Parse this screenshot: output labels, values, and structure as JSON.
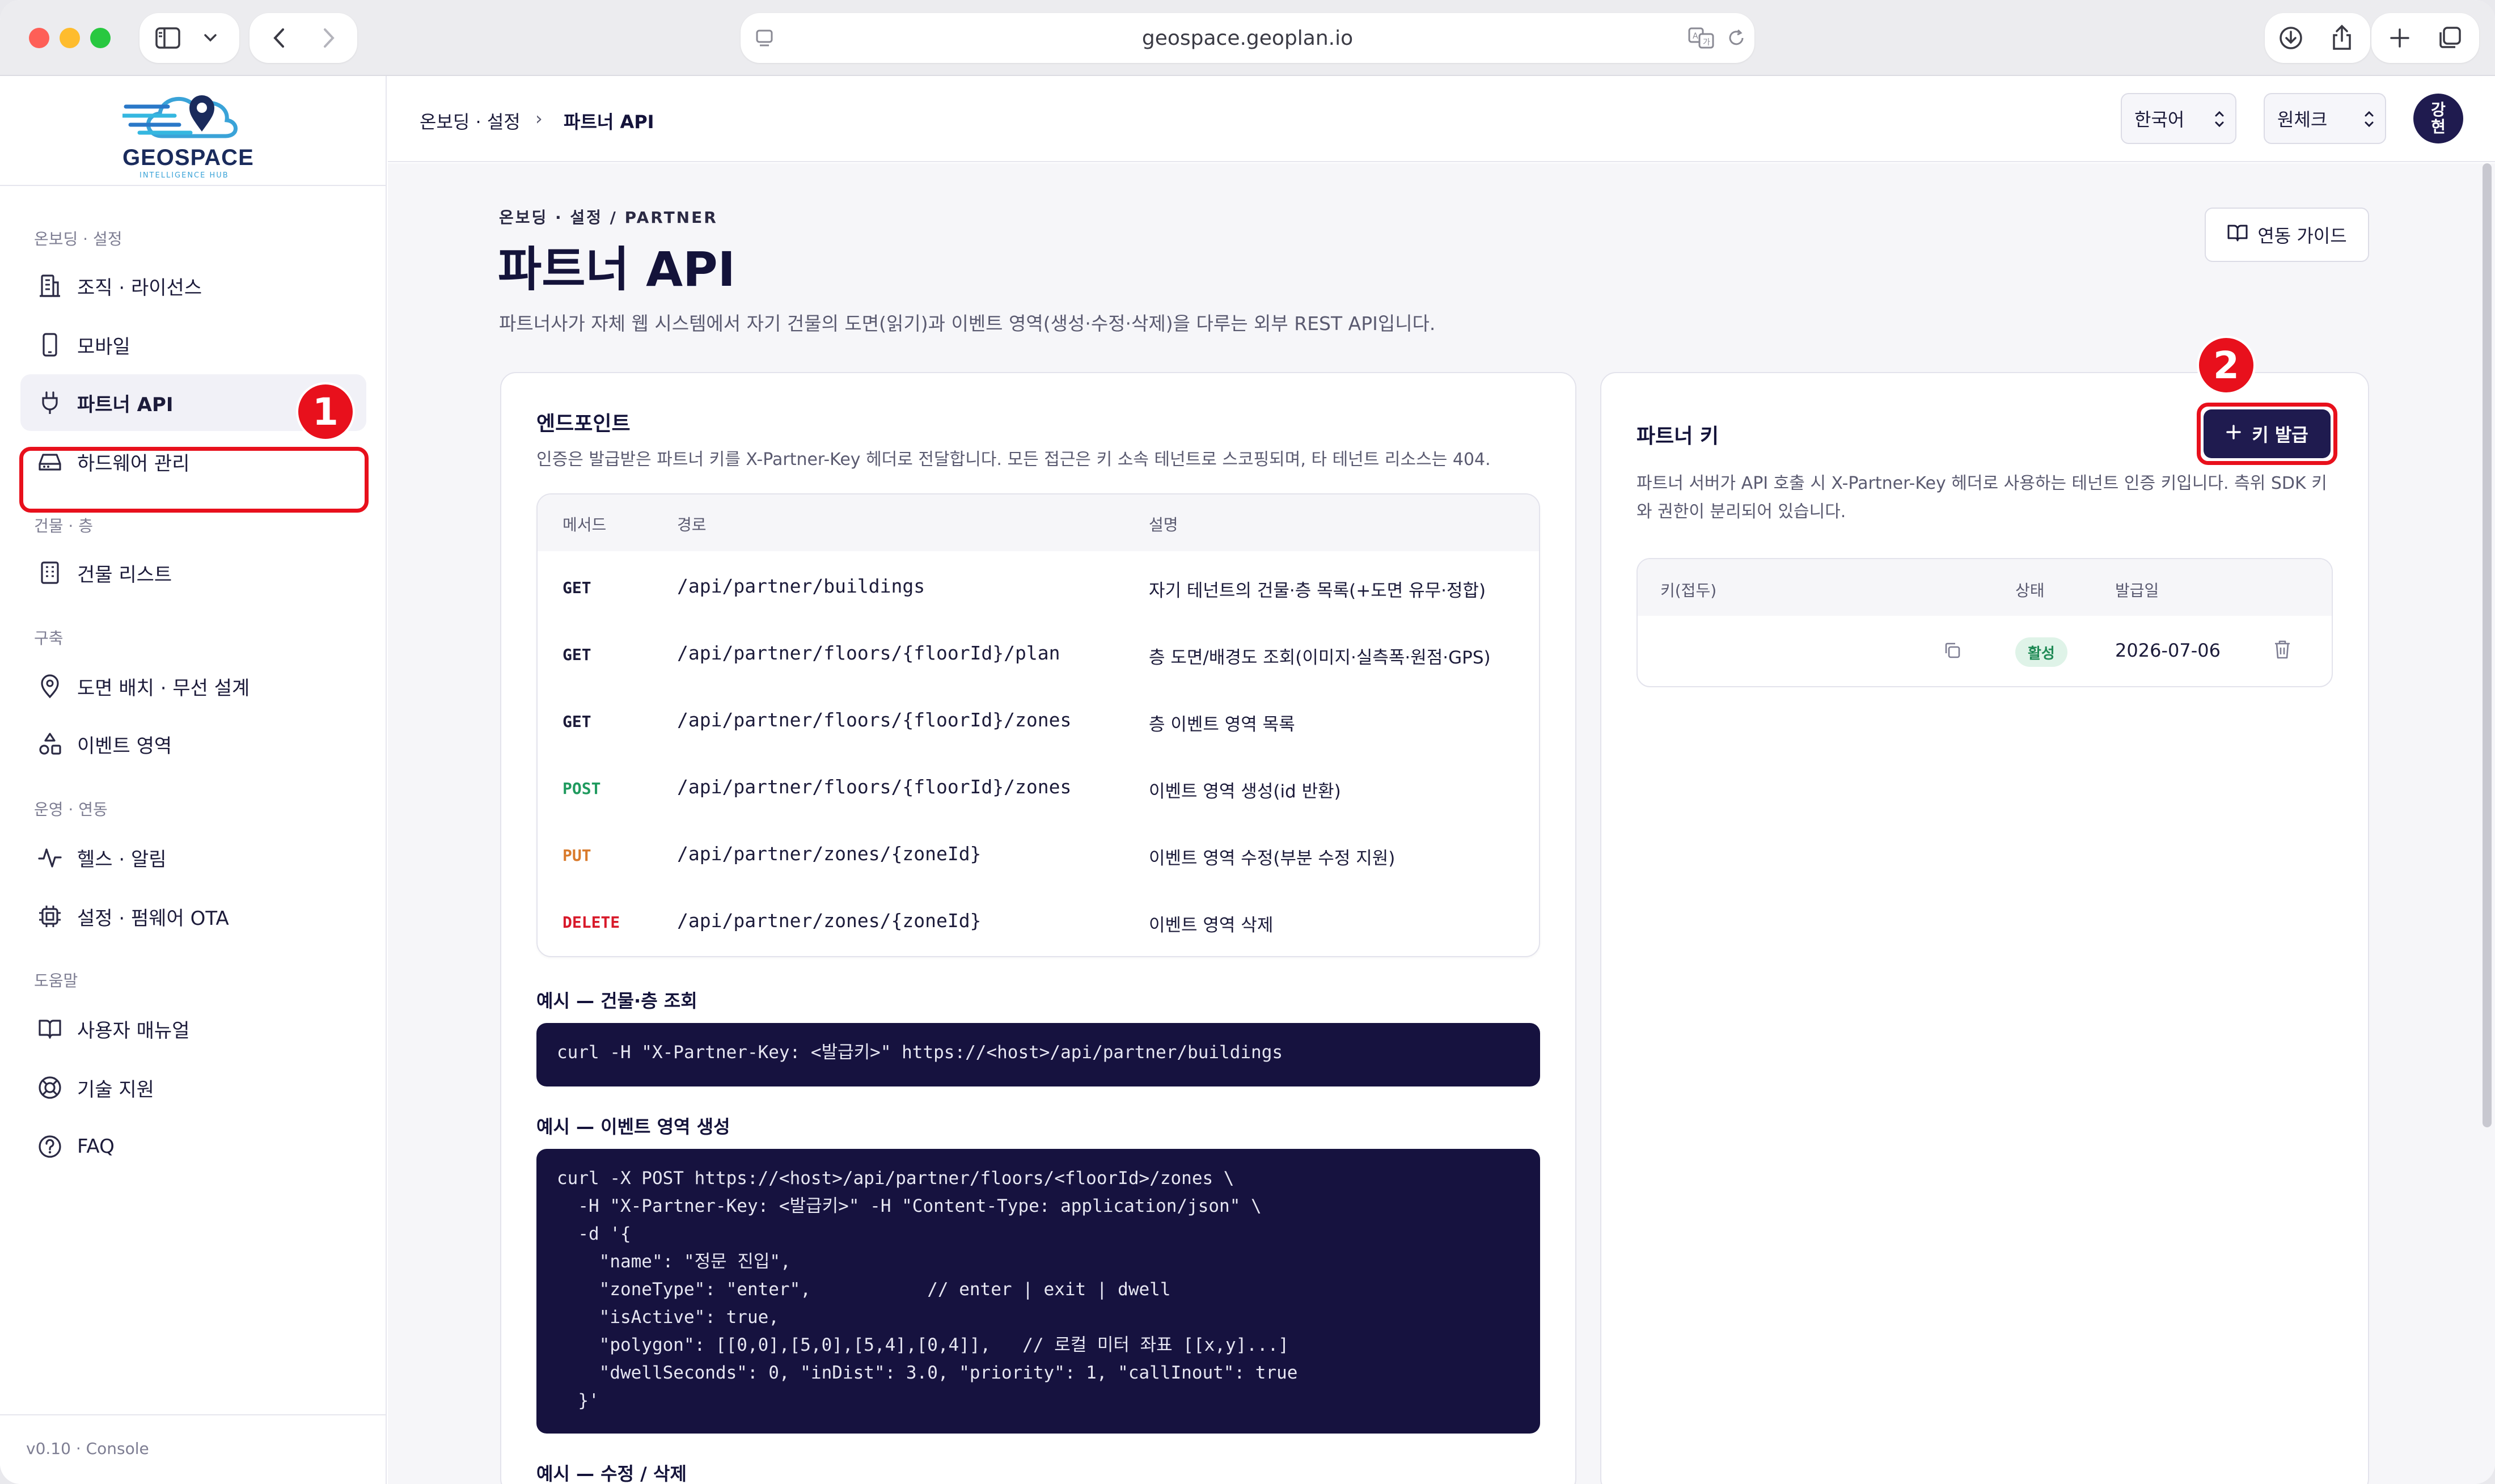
{
  "browser": {
    "url": "geospace.geoplan.io"
  },
  "sidebar": {
    "logo_text": "GEOSPACE",
    "logo_sub": "INTELLIGENCE HUB",
    "sections": [
      {
        "label": "온보딩 · 설정"
      },
      {
        "label": "건물 · 층"
      },
      {
        "label": "구축"
      },
      {
        "label": "운영 · 연동"
      },
      {
        "label": "도움말"
      }
    ],
    "items": [
      {
        "label": "조직 · 라이선스",
        "icon": "building-icon"
      },
      {
        "label": "모바일",
        "icon": "mobile-icon"
      },
      {
        "label": "파트너 API",
        "icon": "plug-icon"
      },
      {
        "label": "하드웨어 관리",
        "icon": "hardware-icon"
      },
      {
        "label": "건물 리스트",
        "icon": "building-list-icon"
      },
      {
        "label": "도면 배치 · 무선 설계",
        "icon": "location-pin-icon"
      },
      {
        "label": "이벤트 영역",
        "icon": "shapes-icon"
      },
      {
        "label": "헬스 · 알림",
        "icon": "activity-icon"
      },
      {
        "label": "설정 · 펌웨어 OTA",
        "icon": "chip-icon"
      },
      {
        "label": "사용자 매뉴얼",
        "icon": "book-icon"
      },
      {
        "label": "기술 지원",
        "icon": "lifebuoy-icon"
      },
      {
        "label": "FAQ",
        "icon": "question-icon"
      }
    ],
    "active_item": "파트너 API",
    "version": "v0.10 · Console"
  },
  "annotations": {
    "badge1": "1",
    "badge2": "2"
  },
  "topbar": {
    "breadcrumb_parent": "온보딩 · 설정",
    "breadcrumb_sep": "›",
    "breadcrumb_current": "파트너 API",
    "language": "한국어",
    "tenant": "원체크",
    "avatar_text": "강\n현"
  },
  "page": {
    "eyebrow": "온보딩 · 설정 / PARTNER",
    "title": "파트너 API",
    "description": "파트너사가 자체 웹 시스템에서 자기 건물의 도면(읽기)과 이벤트 영역(생성·수정·삭제)을 다루는 외부 REST API입니다.",
    "guide_button": "연동 가이드"
  },
  "endpoints": {
    "title": "엔드포인트",
    "description": "인증은 발급받은 파트너 키를 X-Partner-Key 헤더로 전달합니다. 모든 접근은 키 소속 테넌트로 스코핑되며, 타 테넌트 리소스는 404.",
    "columns": [
      "메서드",
      "경로",
      "설명"
    ],
    "rows": [
      {
        "method": "GET",
        "path": "/api/partner/buildings",
        "desc": "자기 테넌트의 건물·층 목록(+도면 유무·정합)"
      },
      {
        "method": "GET",
        "path": "/api/partner/floors/{floorId}/plan",
        "desc": "층 도면/배경도 조회(이미지·실측폭·원점·GPS)"
      },
      {
        "method": "GET",
        "path": "/api/partner/floors/{floorId}/zones",
        "desc": "층 이벤트 영역 목록"
      },
      {
        "method": "POST",
        "path": "/api/partner/floors/{floorId}/zones",
        "desc": "이벤트 영역 생성(id 반환)"
      },
      {
        "method": "PUT",
        "path": "/api/partner/zones/{zoneId}",
        "desc": "이벤트 영역 수정(부분 수정 지원)"
      },
      {
        "method": "DELETE",
        "path": "/api/partner/zones/{zoneId}",
        "desc": "이벤트 영역 삭제"
      }
    ],
    "method_colors": {
      "GET": "#1c1b3a",
      "POST": "#1f9a5e",
      "PUT": "#d97a2b",
      "DELETE": "#d8192a"
    }
  },
  "examples": [
    {
      "title": "예시 — 건물·층 조회",
      "code": "curl -H \"X-Partner-Key: <발급키>\" https://<host>/api/partner/buildings"
    },
    {
      "title": "예시 — 이벤트 영역 생성",
      "code": "curl -X POST https://<host>/api/partner/floors/<floorId>/zones \\\n  -H \"X-Partner-Key: <발급키>\" -H \"Content-Type: application/json\" \\\n  -d '{\n    \"name\": \"정문 진입\",\n    \"zoneType\": \"enter\",           // enter | exit | dwell\n    \"isActive\": true,\n    \"polygon\": [[0,0],[5,0],[5,4],[0,4]],   // 로컬 미터 좌표 [[x,y]...]\n    \"dwellSeconds\": 0, \"inDist\": 3.0, \"priority\": 1, \"callInout\": true\n  }'"
    },
    {
      "title": "예시 — 수정 / 삭제"
    }
  ],
  "partner_keys": {
    "title": "파트너 키",
    "issue_button": "키 발급",
    "description": "파트너 서버가 API 호출 시 X-Partner-Key 헤더로 사용하는 테넌트 인증 키입니다. 측위 SDK 키와 권한이 분리되어 있습니다.",
    "columns": [
      "키(접두)",
      "상태",
      "발급일"
    ],
    "rows": [
      {
        "prefix": "",
        "status": "활성",
        "issued": "2026-07-06"
      }
    ]
  }
}
